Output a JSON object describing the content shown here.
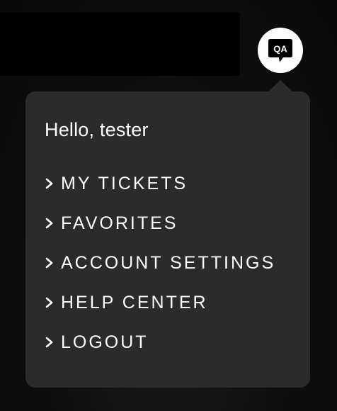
{
  "header": {
    "avatar_initials": "QA"
  },
  "dropdown": {
    "greeting": "Hello, tester",
    "items": [
      {
        "label": "MY TICKETS"
      },
      {
        "label": "FAVORITES"
      },
      {
        "label": "ACCOUNT SETTINGS"
      },
      {
        "label": "HELP CENTER"
      },
      {
        "label": "LOGOUT"
      }
    ]
  },
  "colors": {
    "page_background": "#0b0b0b",
    "header_bar": "#000000",
    "panel_background": "#2b2b2b",
    "avatar_background": "#ffffff",
    "text": "#ffffff"
  },
  "icons": {
    "avatar": "speech-bubble-icon",
    "menu_item": "chevron-right-icon"
  }
}
